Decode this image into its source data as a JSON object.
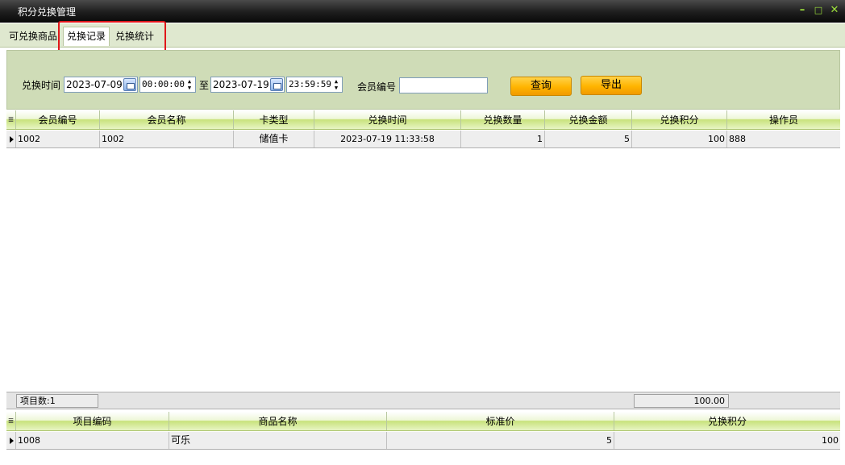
{
  "window": {
    "title": "积分兑换管理",
    "minimize_glyph": "–",
    "maximize_glyph": "□",
    "close_glyph": "✕"
  },
  "tabs": [
    {
      "label": "可兑换商品",
      "active": false
    },
    {
      "label": "兑换记录",
      "active": true
    },
    {
      "label": "兑换统计",
      "active": false
    }
  ],
  "filter": {
    "time_label": "兑换时间",
    "start_date": "2023-07-09",
    "start_time": "00:00:00",
    "to_label": "至",
    "end_date": "2023-07-19",
    "end_time": "23:59:59",
    "member_label": "会员编号",
    "member_value": "",
    "query_button": "查询",
    "export_button": "导出"
  },
  "records": {
    "columns": [
      "会员编号",
      "会员名称",
      "卡类型",
      "兑换时间",
      "兑换数量",
      "兑换金额",
      "兑换积分",
      "操作员"
    ],
    "rows": [
      [
        "1002",
        "1002",
        "储值卡",
        "2023-07-19 11:33:58",
        "1",
        "5",
        "100",
        "888"
      ]
    ]
  },
  "summary": {
    "item_count": "项目数:1",
    "total_points": "100.00"
  },
  "details": {
    "columns": [
      "项目编码",
      "商品名称",
      "标准价",
      "兑换积分"
    ],
    "rows": [
      [
        "1008",
        "可乐",
        "5",
        "100"
      ]
    ]
  },
  "colors": {
    "accent_green": "#9ee23c",
    "button_orange": "#ffb400",
    "highlight_red": "#e0161a"
  }
}
